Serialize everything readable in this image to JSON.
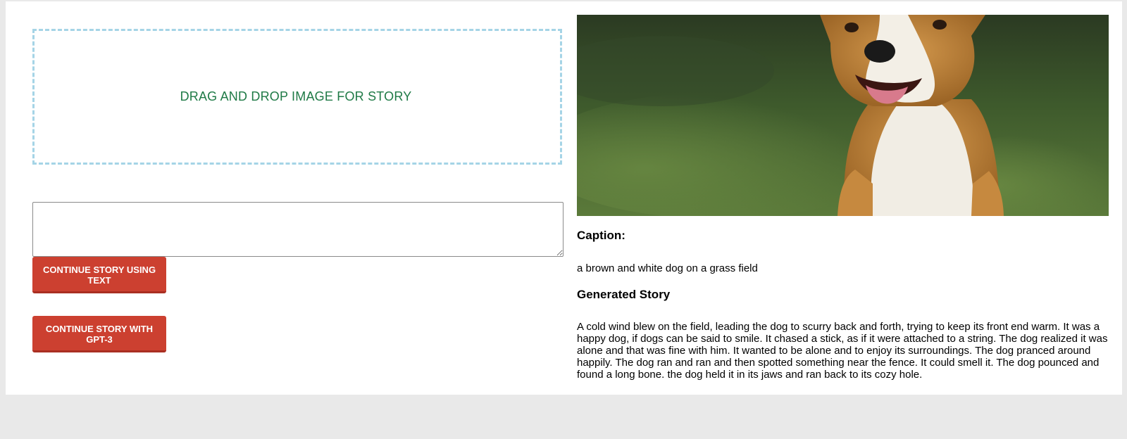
{
  "upload": {
    "dropzone_label": "DRAG AND DROP IMAGE FOR STORY"
  },
  "story_input": {
    "value": "",
    "placeholder": ""
  },
  "buttons": {
    "continue_text": "CONTINUE STORY USING TEXT",
    "continue_gpt3": "CONTINUE STORY WITH GPT-3"
  },
  "image": {
    "subject": "dog-photo"
  },
  "caption": {
    "heading": "Caption:",
    "text": "a brown and white dog on a grass field"
  },
  "story": {
    "heading": "Generated Story",
    "text": "A cold wind blew on the field, leading the dog to scurry back and forth, trying to keep its front end warm. It was a happy dog, if dogs can be said to smile. It chased a stick, as if it were attached to a string. The dog realized it was alone and that was fine with him. It wanted to be alone and to enjoy its surroundings. The dog pranced around happily. The dog ran and ran and then spotted something near the fence. It could smell it. The dog pounced and found a long bone. the dog held it in its jaws and ran back to its cozy hole."
  },
  "colors": {
    "page_background": "#e9e9e9",
    "panel_background": "#ffffff",
    "dropzone_border": "#a5d4e6",
    "dropzone_text": "#1f7a46",
    "button_background": "#cc4030",
    "button_text": "#ffffff"
  }
}
